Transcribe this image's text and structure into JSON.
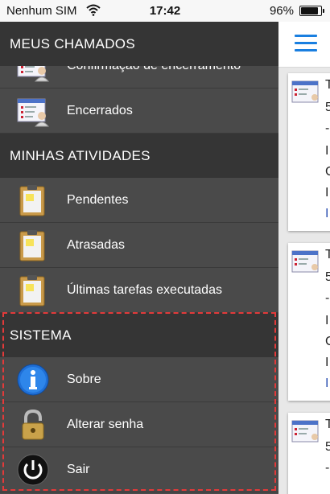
{
  "status_bar": {
    "carrier": "Nenhum SIM",
    "time": "17:42",
    "battery": "96%"
  },
  "menu": {
    "meus_chamados": {
      "header": "MEUS CHAMADOS",
      "items": [
        {
          "label": "Confirmação de encerramento",
          "icon": "ticket-form-icon"
        },
        {
          "label": "Encerrados",
          "icon": "ticket-form-icon"
        }
      ]
    },
    "minhas_atividades": {
      "header": "MINHAS ATIVIDADES",
      "items": [
        {
          "label": "Pendentes",
          "icon": "clipboard-icon"
        },
        {
          "label": "Atrasadas",
          "icon": "clipboard-icon"
        },
        {
          "label": "Últimas tarefas executadas",
          "icon": "clipboard-icon"
        }
      ]
    },
    "sistema": {
      "header": "SISTEMA",
      "items": [
        {
          "label": "Sobre",
          "icon": "info-icon"
        },
        {
          "label": "Alterar senha",
          "icon": "padlock-icon"
        },
        {
          "label": "Sair",
          "icon": "power-icon"
        }
      ]
    }
  },
  "content": {
    "cards": [
      {
        "lines": [
          "T",
          "5",
          "-",
          "I",
          "C",
          "I",
          "I"
        ]
      },
      {
        "lines": [
          "T",
          "5",
          "-",
          "I",
          "C",
          "I",
          "I"
        ]
      },
      {
        "lines": [
          "T",
          "5",
          "-"
        ]
      }
    ]
  },
  "colors": {
    "menu_bg": "#4a4a4a",
    "section_bg": "#353535",
    "accent": "#1a7fe0",
    "highlight_border": "#e33a3a"
  }
}
